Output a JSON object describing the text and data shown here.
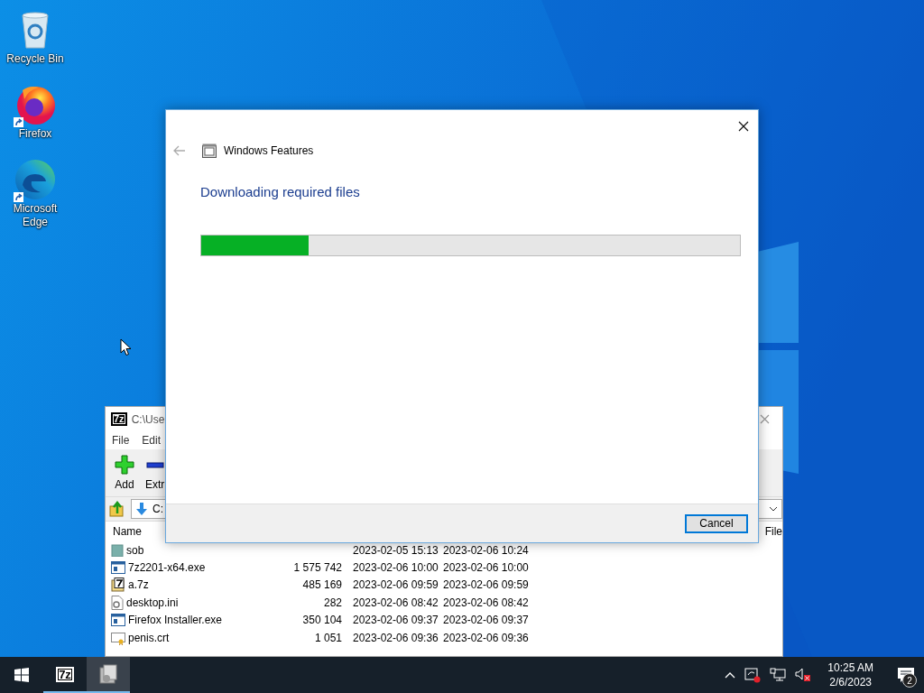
{
  "desktop_icons": [
    {
      "label": "Recycle Bin",
      "kind": "recycle"
    },
    {
      "label": "Firefox",
      "kind": "firefox",
      "shortcut": true
    },
    {
      "label": "Microsoft Edge",
      "kind": "edge",
      "shortcut": true
    }
  ],
  "archive_window": {
    "logo": "7z",
    "title": "C:\\Use",
    "menu": [
      "File",
      "Edit"
    ],
    "toolbar": [
      {
        "label": "Add",
        "kind": "add"
      },
      {
        "label": "Extr",
        "kind": "extract"
      }
    ],
    "path": "C:",
    "columns": [
      "Name",
      "File"
    ],
    "rows": [
      {
        "name": "sob",
        "kind": "folder",
        "modified": "2023-02-05 15:13",
        "created": "2023-02-06 10:24"
      },
      {
        "name": "7z2201-x64.exe",
        "kind": "exe",
        "size": "1 575 742",
        "modified": "2023-02-06 10:00",
        "created": "2023-02-06 10:00"
      },
      {
        "name": "a.7z",
        "kind": "archive",
        "size": "485 169",
        "modified": "2023-02-06 09:59",
        "created": "2023-02-06 09:59"
      },
      {
        "name": "desktop.ini",
        "kind": "settings",
        "size": "282",
        "modified": "2023-02-06 08:42",
        "created": "2023-02-06 08:42"
      },
      {
        "name": "Firefox Installer.exe",
        "kind": "exe",
        "size": "350 104",
        "modified": "2023-02-06 09:37",
        "created": "2023-02-06 09:37"
      },
      {
        "name": "penis.crt",
        "kind": "certificate",
        "size": "1 051",
        "modified": "2023-02-06 09:36",
        "created": "2023-02-06 09:36"
      }
    ]
  },
  "dialog": {
    "title": "Windows Features",
    "heading": "Downloading required files",
    "progress": {
      "level": 0.2
    },
    "buttons": [
      "Cancel"
    ]
  },
  "taskbar": {
    "apps": [
      {
        "kind": "archiver",
        "logo": "7z",
        "selected": false
      },
      {
        "kind": "features",
        "selected": true
      }
    ],
    "time": "10:25 AM",
    "date": "2/6/2023",
    "notifications": "2"
  }
}
